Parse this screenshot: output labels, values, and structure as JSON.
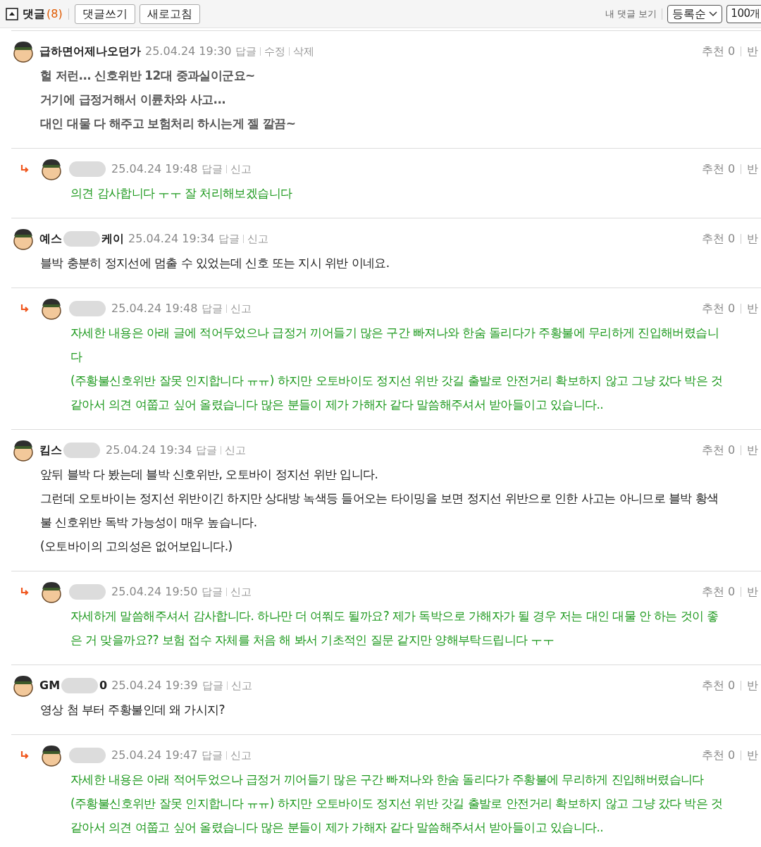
{
  "header": {
    "title": "댓글",
    "count": "(8)",
    "collapsed": false,
    "buttons": [
      "댓글쓰기",
      "새로고침"
    ],
    "my_comments": "내 댓글 보기",
    "sort": "등록순",
    "per_page": "100개"
  },
  "comments": [
    {
      "kind": "comment",
      "bold": true,
      "name": "급하면어제나오던가",
      "date": "25.04.24 19:30",
      "actions": [
        "답글",
        "수정",
        "삭제"
      ],
      "recommend": "추천 0",
      "side": "반",
      "lines": [
        "헐 저런... 신호위반 12대 중과실이군요~",
        "거기에 급정거해서 이륜차와 사고...",
        "대인 대물 다 해주고 보험처리 하시는게 젤 깔끔~"
      ]
    },
    {
      "kind": "reply",
      "bold": false,
      "redacted": true,
      "date": "25.04.24 19:48",
      "actions": [
        "답글",
        "신고"
      ],
      "recommend": "추천 0",
      "side": "반",
      "lines": [
        "의견 감사합니다 ㅜㅜ 잘 처리해보겠습니다"
      ]
    },
    {
      "kind": "comment",
      "bold": false,
      "name": "예스",
      "name_tail": "케이",
      "redacted": true,
      "date": "25.04.24 19:34",
      "actions": [
        "답글",
        "신고"
      ],
      "recommend": "추천 0",
      "side": "반",
      "lines": [
        "블박 충분히 정지선에 멈출 수 있었는데 신호 또는 지시 위반 이네요."
      ]
    },
    {
      "kind": "reply",
      "bold": false,
      "redacted": true,
      "date": "25.04.24 19:48",
      "actions": [
        "답글",
        "신고"
      ],
      "recommend": "추천 0",
      "side": "반",
      "lines": [
        "자세한 내용은 아래 글에 적어두었으나 급정거 끼어들기 많은 구간 빠져나와 한숨 돌리다가 주황불에 무리하게 진입해버렸습니",
        "다",
        "(주황불신호위반 잘못 인지합니다 ㅠㅠ) 하지만 오토바이도 정지선 위반 갓길 출발로 안전거리 확보하지 않고 그냥 갔다 박은 것",
        "같아서 의견 여쭙고 싶어 올렸습니다 많은 분들이 제가 가해자 같다 말씀해주셔서 받아들이고 있습니다.."
      ]
    },
    {
      "kind": "comment",
      "bold": false,
      "name": "킴스",
      "redacted": true,
      "date": "25.04.24 19:34",
      "actions": [
        "답글",
        "신고"
      ],
      "recommend": "추천 0",
      "side": "반",
      "lines": [
        "앞뒤 블박 다 봤는데 블박 신호위반, 오토바이 정지선 위반 입니다.",
        "그런데 오토바이는 정지선 위반이긴 하지만 상대방 녹색등 들어오는 타이밍을 보면 정지선 위반으로 인한 사고는 아니므로 블박 황색",
        "불 신호위반 독박 가능성이 매우 높습니다.",
        "(오토바이의 고의성은 없어보입니다.)"
      ]
    },
    {
      "kind": "reply",
      "bold": false,
      "redacted": true,
      "date": "25.04.24 19:50",
      "actions": [
        "답글",
        "신고"
      ],
      "recommend": "추천 0",
      "side": "반",
      "lines": [
        "자세하게 말씀해주셔서 감사합니다. 하나만 더 여쭤도 될까요? 제가 독박으로 가해자가 될 경우 저는 대인 대물 안 하는 것이 좋",
        "은 거 맞을까요?? 보험 접수 자체를 처음 해 봐서 기초적인 질문 같지만 양해부탁드립니다 ㅜㅜ"
      ]
    },
    {
      "kind": "comment",
      "bold": false,
      "name": "GM",
      "name_tail": "0",
      "redacted": true,
      "date": "25.04.24 19:39",
      "actions": [
        "답글",
        "신고"
      ],
      "recommend": "추천 0",
      "side": "반",
      "lines": [
        "영상 첨 부터 주황불인데 왜 가시지?"
      ]
    },
    {
      "kind": "reply",
      "bold": false,
      "redacted": true,
      "date": "25.04.24 19:47",
      "actions": [
        "답글",
        "신고"
      ],
      "recommend": "추천 0",
      "side": "반",
      "lines": [
        "자세한 내용은 아래 적어두었으나 급정거 끼어들기 많은 구간 빠져나와 한숨 돌리다가 주황불에 무리하게 진입해버렸습니다",
        "(주황불신호위반 잘못 인지합니다 ㅠㅠ) 하지만 오토바이도 정지선 위반 갓길 출발로 안전거리 확보하지 않고 그냥 갔다 박은 것",
        "같아서 의견 여쭙고 싶어 올렸습니다 많은 분들이 제가 가해자 같다 말씀해주셔서 받아들이고 있습니다.."
      ]
    }
  ]
}
